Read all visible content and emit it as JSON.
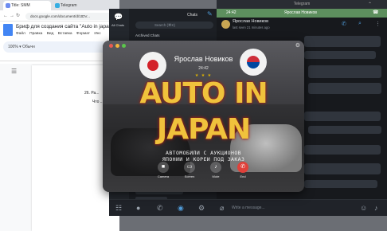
{
  "browser": {
    "tabs": [
      {
        "label": "Title: SMM",
        "active": true
      },
      {
        "label": "Telegram",
        "active": false
      }
    ],
    "url": "docs.google.com/document/d/1tDV...",
    "doc_title": "Бриф для создания сайта \"Auto in japan\"",
    "menu": [
      "Файл",
      "Правка",
      "Вид",
      "Вставка",
      "Формат",
      "Инс"
    ],
    "toolbar_text": "100%  ▾   Обычн",
    "lines": [
      "26. Ра...",
      "Что ..."
    ]
  },
  "telegram": {
    "window_title": "Telegram",
    "chats_title": "Chats",
    "all_chats": "All Chats",
    "search_placeholder": "Search (⌘K)",
    "archived": "Archived Chats",
    "active_call_bar": {
      "time": "24:42",
      "name": "Ярослав Новиков"
    },
    "contact_name": "Ярослав Новиков",
    "contact_status": "last seen 21 minutes ago",
    "message_placeholder": "Write a message..."
  },
  "call": {
    "caller_name": "Ярослав Новиков",
    "duration": "24:42",
    "stars": "★ ★ ★",
    "headline_1": "AUTO IN",
    "headline_2": "JAPAN",
    "subtitle_1": "АВТОМОБИЛИ С АУКЦИОНОВ",
    "subtitle_2": "ЯПОНИИ И КОРЕИ ПОД ЗАКАЗ",
    "controls": [
      {
        "label": "Camera",
        "icon": "camera-icon"
      },
      {
        "label": "Screen",
        "icon": "screen-share-icon"
      },
      {
        "label": "Mute",
        "icon": "microphone-icon"
      },
      {
        "label": "End",
        "icon": "end-call-icon"
      }
    ]
  },
  "colors": {
    "telegram_bg": "#1c1f24",
    "call_end": "#e0413a",
    "headline": "#f0c23c",
    "call_bar_green": "#5d8f5e"
  }
}
